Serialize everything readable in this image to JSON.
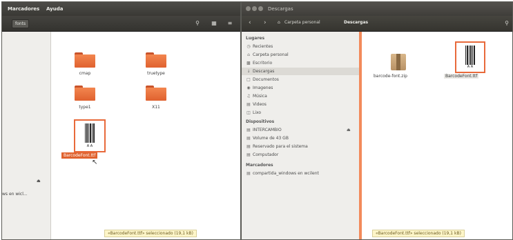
{
  "left_window": {
    "menu": [
      "Marcadores",
      "Ayuda"
    ],
    "path_button": "fonts",
    "toolbar_icons": [
      "search-icon",
      "list-view-icon",
      "menu-icon"
    ],
    "folders": [
      "cmap",
      "truetype",
      "type1",
      "X11"
    ],
    "selected_file": "BarcodeFont.ttf",
    "sidebar_device_text": "ws en wicl...",
    "status": "«BarcodeFont.ttf» seleccionado (19,1 kB)"
  },
  "right_window": {
    "title": "Descargas",
    "breadcrumb": [
      "Carpeta personal",
      "Descargas"
    ],
    "sidebar": {
      "places_heading": "Lugares",
      "places": [
        {
          "label": "Recientes",
          "icon": "clock-icon"
        },
        {
          "label": "Carpeta personal",
          "icon": "home-icon"
        },
        {
          "label": "Escritorio",
          "icon": "desktop-icon"
        },
        {
          "label": "Descargas",
          "icon": "download-icon",
          "active": true
        },
        {
          "label": "Documentos",
          "icon": "document-icon"
        },
        {
          "label": "Imagenes",
          "icon": "camera-icon"
        },
        {
          "label": "Música",
          "icon": "music-icon"
        },
        {
          "label": "Videos",
          "icon": "film-icon"
        },
        {
          "label": "Lixo",
          "icon": "trash-icon"
        }
      ],
      "devices_heading": "Dispositivos",
      "devices": [
        {
          "label": "INTERCAMBIO",
          "icon": "drive-icon"
        },
        {
          "label": "Volume de 43 GB",
          "icon": "drive-icon"
        },
        {
          "label": "Reservado para el sistema",
          "icon": "drive-icon"
        },
        {
          "label": "Computador",
          "icon": "computer-icon"
        }
      ],
      "bookmarks_heading": "Marcadores",
      "bookmarks": [
        {
          "label": "compartida_windows en wcilent",
          "icon": "network-icon"
        }
      ]
    },
    "files": [
      {
        "name": "barcode-font.zip",
        "kind": "archive"
      },
      {
        "name": "BarcodeFont.ttf",
        "kind": "font"
      }
    ],
    "status": "«BarcodeFont.ttf» seleccionado (19,1 kB)"
  }
}
